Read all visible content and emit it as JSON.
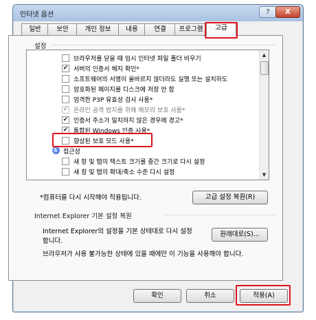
{
  "window": {
    "title": "인터넷 옵션",
    "help": "?",
    "close": "X"
  },
  "tabs": [
    "일반",
    "보안",
    "개인 정보",
    "내용",
    "연결",
    "프로그램",
    "고급"
  ],
  "settings": {
    "label": "설정",
    "items": [
      {
        "text": "브라우저를 닫을 때 임시 인터넷 파일 폴더 비우기",
        "checked": false,
        "disabled": false
      },
      {
        "text": "서버의 인증서 해지 확인*",
        "checked": true,
        "disabled": false
      },
      {
        "text": "소프트웨어의 서명이 올바르지 않더라도 실행 또는 설치하도",
        "checked": false,
        "disabled": false
      },
      {
        "text": "암호화된 페이지를 디스크에 저장 안 함",
        "checked": false,
        "disabled": false
      },
      {
        "text": "엄격한 P3P 유효성 검사 사용*",
        "checked": false,
        "disabled": false
      },
      {
        "text": "온라인 공격 방지를 위해 메모리 보호 사용*",
        "checked": true,
        "disabled": true
      },
      {
        "text": "인증서 주소가 일치하지 않은 경우에 경고*",
        "checked": true,
        "disabled": false
      },
      {
        "text": "통합된 Windows 인증 사용*",
        "checked": true,
        "disabled": false
      },
      {
        "text": "향상된 보호 모드 사용*",
        "checked": false,
        "disabled": false
      },
      {
        "text": "접근성",
        "category": true
      },
      {
        "text": "새 창 및 탭의 텍스트 크기를 중간 크기로 다시 설정",
        "checked": false,
        "disabled": false
      },
      {
        "text": "새 창 및 탭의 확대/축소 수준 다시 설정",
        "checked": false,
        "disabled": false
      }
    ]
  },
  "restart_note": "*컴퓨터를 다시 시작해야 적용됩니다.",
  "restore_advanced_button": "고급 설정 복원(R)",
  "reset_section": {
    "label": "Internet Explorer 기본 설정 복원",
    "description_line1": "Internet Explorer의 설정을 기본 상태대로 다시 설정",
    "description_line2": "합니다.",
    "reset_button": "원래대로(S)...",
    "warning": "브라우저가 사용 불가능한 상태에 있을 때에만 이 기능을 사용해야 합니다."
  },
  "footer": {
    "ok": "확인",
    "cancel": "취소",
    "apply": "적용(A)"
  },
  "colors": {
    "highlight": "#e1121c",
    "title_bar": "#b7cfeb"
  }
}
